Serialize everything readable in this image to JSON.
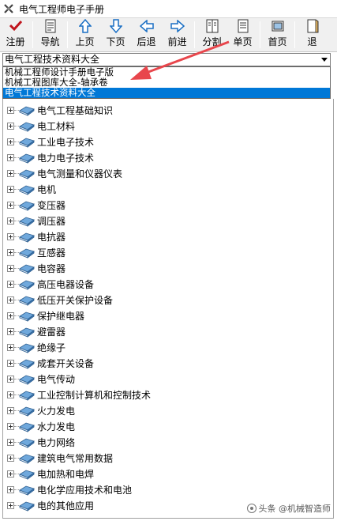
{
  "window": {
    "title": "电气工程师电子手册"
  },
  "toolbar": {
    "buttons": [
      {
        "label": "注册",
        "icon": "register-checkmark-icon"
      },
      {
        "label": "导航",
        "icon": "navigation-document-icon"
      },
      {
        "label": "上页",
        "icon": "arrow-up-icon"
      },
      {
        "label": "下页",
        "icon": "arrow-down-icon"
      },
      {
        "label": "后退",
        "icon": "arrow-left-icon"
      },
      {
        "label": "前进",
        "icon": "arrow-right-icon"
      },
      {
        "label": "分割",
        "icon": "split-document-icon"
      },
      {
        "label": "单页",
        "icon": "single-page-icon"
      },
      {
        "label": "首页",
        "icon": "home-icon"
      },
      {
        "label": "退",
        "icon": "exit-icon"
      }
    ]
  },
  "combo": {
    "selected_value": "电气工程技术资料大全"
  },
  "dropdown": {
    "options": [
      {
        "label": "机械工程师设计手册电子版",
        "selected": false
      },
      {
        "label": "机械工程图库大全-轴承卷",
        "selected": false
      },
      {
        "label": "电气工程技术资料大全",
        "selected": true
      }
    ]
  },
  "tree": {
    "nodes": [
      "电气工程基础知识",
      "电工材料",
      "工业电子技术",
      "电力电子技术",
      "电气测量和仪器仪表",
      "电机",
      "变压器",
      "调压器",
      "电抗器",
      "互感器",
      "电容器",
      "高压电器设备",
      "低压开关保护设备",
      "保护继电器",
      "避雷器",
      "绝缘子",
      "成套开关设备",
      "电气传动",
      "工业控制计算机和控制技术",
      "火力发电",
      "水力发电",
      "电力网络",
      "建筑电气常用数据",
      "电加热和电焊",
      "电化学应用技术和电池",
      "电的其他应用"
    ]
  },
  "watermark": {
    "text": "头条 @机械智造师"
  },
  "colors": {
    "selection": "#0078d7",
    "annotation_arrow": "#e8464c",
    "toolbar_bg": "#f0f0f0"
  }
}
